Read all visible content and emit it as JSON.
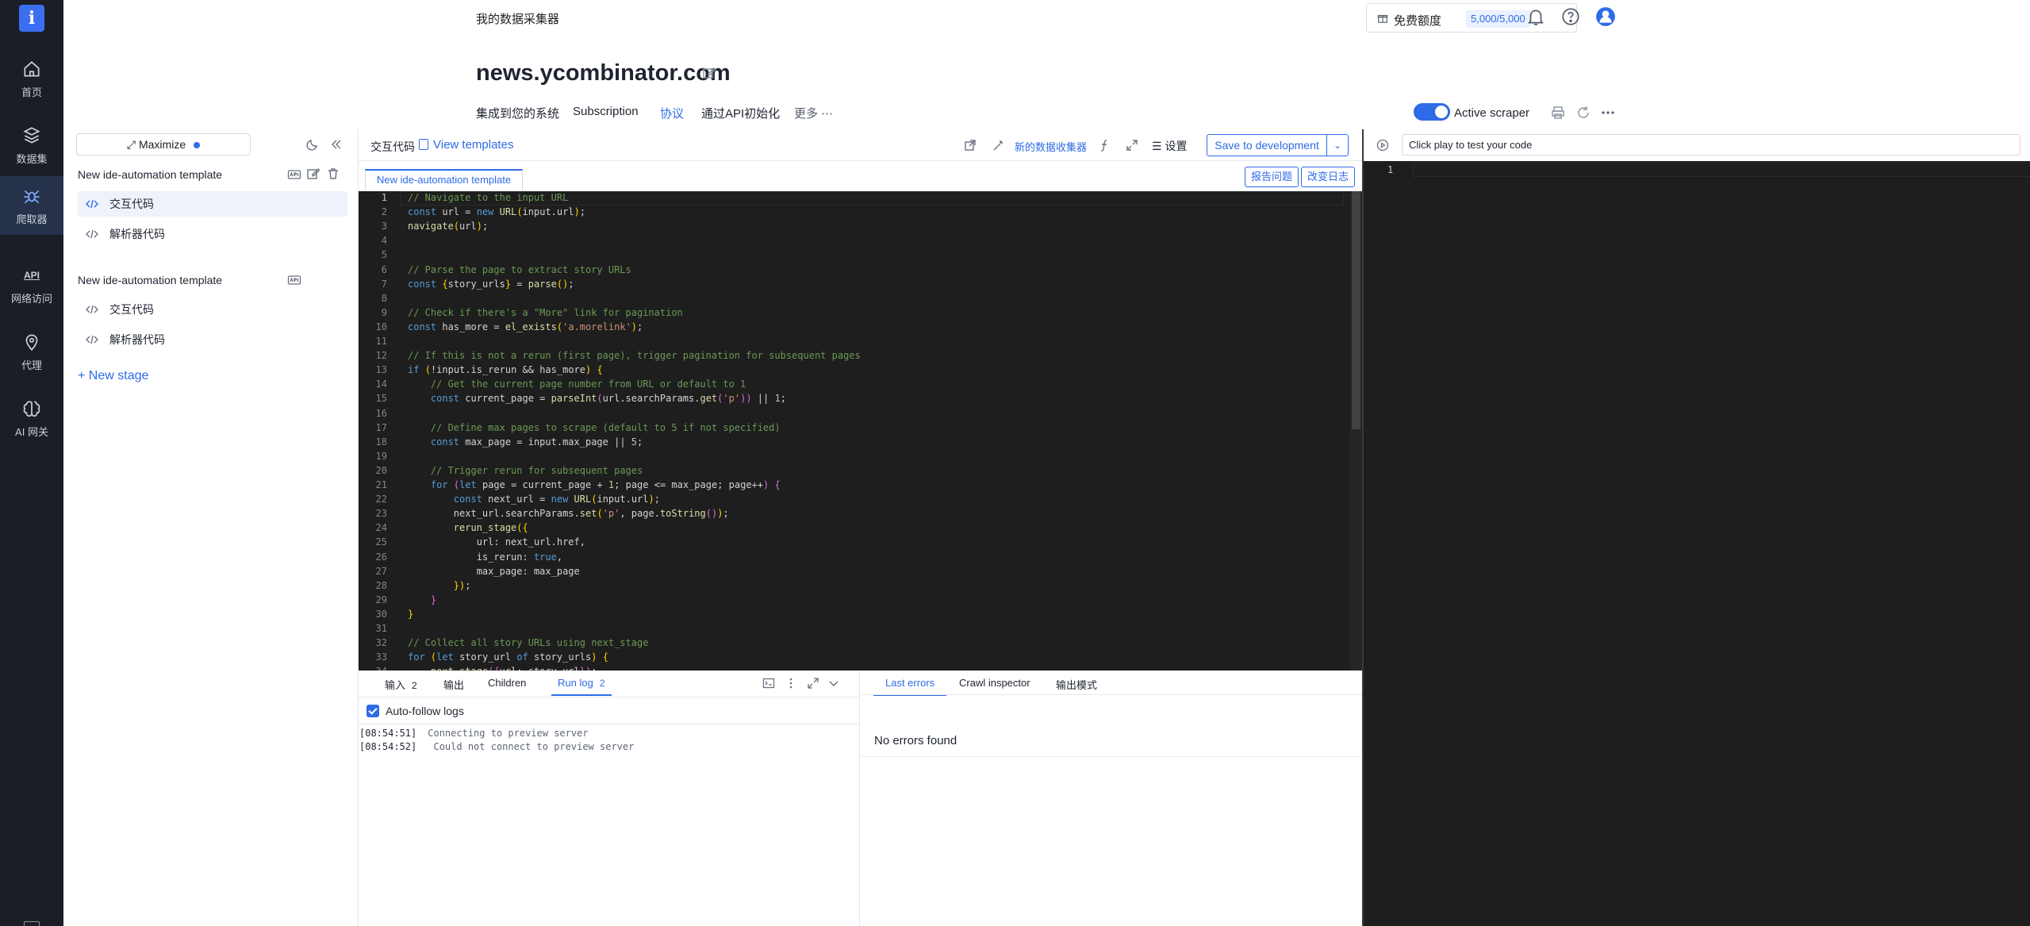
{
  "rail": {
    "items": [
      {
        "label": "首页",
        "icon": "home-icon"
      },
      {
        "label": "数据集",
        "icon": "database-icon"
      },
      {
        "label": "爬取器",
        "icon": "spider-icon"
      },
      {
        "label": "网络访问",
        "icon": "api-icon"
      },
      {
        "label": "代理",
        "icon": "location-pin-icon"
      },
      {
        "label": "AI 网关",
        "icon": "brain-icon"
      }
    ],
    "api_text": "API"
  },
  "header": {
    "collector_title": "我的数据采集器",
    "quota_label": "免费额度",
    "quota_value": "5,000/5,000",
    "site_title": "news.ycombinator.com",
    "tabs": [
      "集成到您的系统",
      "Subscription",
      "协议",
      "通过API初始化"
    ],
    "more_label": "更多",
    "active_scraper_label": "Active scraper"
  },
  "stages": {
    "maximize_label": "Maximize",
    "groups": [
      {
        "title": "New ide-automation template",
        "items": [
          "交互代码",
          "解析器代码"
        ]
      },
      {
        "title": "New ide-automation template",
        "items": [
          "交互代码",
          "解析器代码"
        ]
      }
    ],
    "new_stage_label": "+ New stage"
  },
  "editor_toolbar": {
    "label": "交互代码",
    "view_templates": "View templates",
    "new_collector": "新的数据收集器",
    "settings": "设置",
    "save": "Save to development",
    "file_tab": "New ide-automation template",
    "report_issue": "报告问题",
    "changelog": "改变日志"
  },
  "code_lines": [
    "<span class=\"c\">// Navigate to the input URL</span>",
    "<span class=\"k\">const</span> url = <span class=\"k\">new</span> <span class=\"f\">URL</span><span class=\"y\">(</span>input.url<span class=\"y\">)</span>;",
    "<span class=\"f\">navigate</span><span class=\"y\">(</span>url<span class=\"y\">)</span>;",
    "",
    "",
    "<span class=\"c\">// Parse the page to extract story URLs</span>",
    "<span class=\"k\">const</span> <span class=\"y\">{</span>story_urls<span class=\"y\">}</span> = <span class=\"f\">parse</span><span class=\"y\">()</span>;",
    "",
    "<span class=\"c\">// Check if there's a \"More\" link for pagination</span>",
    "<span class=\"k\">const</span> has_more = <span class=\"f\">el_exists</span><span class=\"y\">(</span><span class=\"s\">'a.morelink'</span><span class=\"y\">)</span>;",
    "",
    "<span class=\"c\">// If this is not a rerun (first page), trigger pagination for subsequent pages</span>",
    "<span class=\"k\">if</span> <span class=\"y\">(</span>!input.is_rerun &amp;&amp; has_more<span class=\"y\">)</span> <span class=\"y\">{</span>",
    "    <span class=\"c\">// Get the current page number from URL or default to 1</span>",
    "    <span class=\"k\">const</span> current_page = <span class=\"f\">parseInt</span><span class=\"p\">(</span>url.searchParams.<span class=\"f\">get</span><span class=\"p\">(</span><span class=\"s\">'p'</span><span class=\"p\">))</span> || <span class=\"n\">1</span>;",
    "",
    "    <span class=\"c\">// Define max pages to scrape (default to 5 if not specified)</span>",
    "    <span class=\"k\">const</span> max_page = input.max_page || <span class=\"n\">5</span>;",
    "",
    "    <span class=\"c\">// Trigger rerun for subsequent pages</span>",
    "    <span class=\"k\">for</span> <span class=\"p\">(</span><span class=\"k\">let</span> page = current_page + <span class=\"n\">1</span>; page &lt;= max_page; page++<span class=\"p\">)</span> <span class=\"p\">{</span>",
    "        <span class=\"k\">const</span> next_url = <span class=\"k\">new</span> <span class=\"f\">URL</span><span class=\"y\">(</span>input.url<span class=\"y\">)</span>;",
    "        next_url.searchParams.<span class=\"f\">set</span><span class=\"y\">(</span><span class=\"s\">'p'</span>, page.<span class=\"f\">toString</span><span class=\"p\">()</span><span class=\"y\">)</span>;",
    "        <span class=\"f\">rerun_stage</span><span class=\"y\">({</span>",
    "            url: next_url.href,",
    "            is_rerun: <span class=\"k\">true</span>,",
    "            max_page: max_page",
    "        <span class=\"y\">})</span>;",
    "    <span class=\"p\">}</span>",
    "<span class=\"y\">}</span>",
    "",
    "<span class=\"c\">// Collect all story URLs using next_stage</span>",
    "<span class=\"k\">for</span> <span class=\"y\">(</span><span class=\"k\">let</span> story_url <span class=\"k\">of</span> story_urls<span class=\"y\">)</span> <span class=\"y\">{</span>",
    "    <span class=\"f\">next_stage</span><span class=\"p\">({</span>url: story_url<span class=\"p\">})</span>;"
  ],
  "bottom": {
    "tabs": [
      {
        "label": "输入",
        "count": "2"
      },
      {
        "label": "输出",
        "count": ""
      },
      {
        "label": "Children",
        "count": ""
      },
      {
        "label": "Run log",
        "count": "2"
      }
    ],
    "autofollow": "Auto-follow logs",
    "logs": [
      {
        "time": "[08:54:51]",
        "msg": "Connecting to preview server"
      },
      {
        "time": "[08:54:52]",
        "msg": " Could not connect to preview server"
      }
    ],
    "right_tabs": [
      "Last errors",
      "Crawl inspector",
      "输出模式"
    ],
    "no_errors": "No errors found"
  },
  "preview": {
    "placeholder": "Click play to test your code",
    "line_number": "1"
  },
  "colors": {
    "accent": "#2e6be6",
    "rail_bg": "#1b1e26",
    "editor_bg": "#1e1e1e"
  }
}
